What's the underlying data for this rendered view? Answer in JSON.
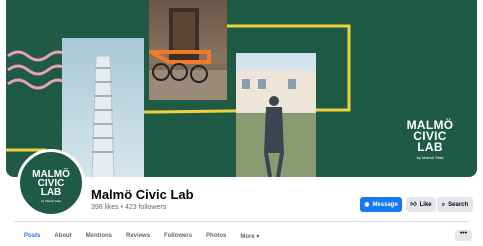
{
  "cover": {
    "logo_lines": [
      "MALMÖ",
      "CIVIC",
      "LAB"
    ],
    "logo_by": "by Malmö Stad"
  },
  "avatar": {
    "logo_lines": [
      "MALMÖ",
      "CIVIC",
      "LAB"
    ],
    "logo_by": "by Malmö Stad"
  },
  "page": {
    "name": "Malmö Civic Lab",
    "stats": "396 likes • 423 followers"
  },
  "actions": {
    "message": "Message",
    "like": "Like",
    "search": "Search"
  },
  "tabs": [
    "Posts",
    "About",
    "Mentions",
    "Reviews",
    "Followers",
    "Photos",
    "More ▾"
  ],
  "more_button": "•••",
  "colors": {
    "cover_bg": "#1f5a45",
    "accent_yellow": "#f2d23c",
    "accent_pink": "#e8a1b6",
    "primary_blue": "#1877f2"
  }
}
